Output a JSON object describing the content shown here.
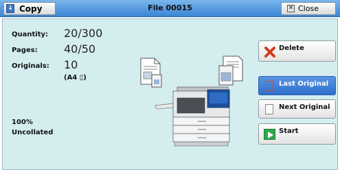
{
  "titlebar": {
    "copy_label": "Copy",
    "file_label": "File 00015",
    "close_label": "Close"
  },
  "info": {
    "quantity_label": "Quantity:",
    "quantity_value": "20/300",
    "pages_label": "Pages:",
    "pages_value": "40/50",
    "originals_label": "Originals:",
    "originals_value": "10",
    "paper_size": "(A4 ▯)",
    "zoom": "100%",
    "collation": "Uncollated"
  },
  "actions": {
    "delete_label": "Delete",
    "last_original_label": "Last Original",
    "next_original_label": "Next Original",
    "start_label": "Start"
  },
  "colors": {
    "titlebar": "#3a85d4",
    "panel": "#d4eef0",
    "selected_button": "#3a7bd5",
    "start_green": "#2ea84a",
    "delete_red": "#d63a1e"
  },
  "icons": [
    "copy-icon",
    "close-icon",
    "delete-icon",
    "last-original-icon",
    "next-original-icon",
    "start-icon",
    "document-in-icon",
    "document-out-icon",
    "copier-machine-image"
  ]
}
